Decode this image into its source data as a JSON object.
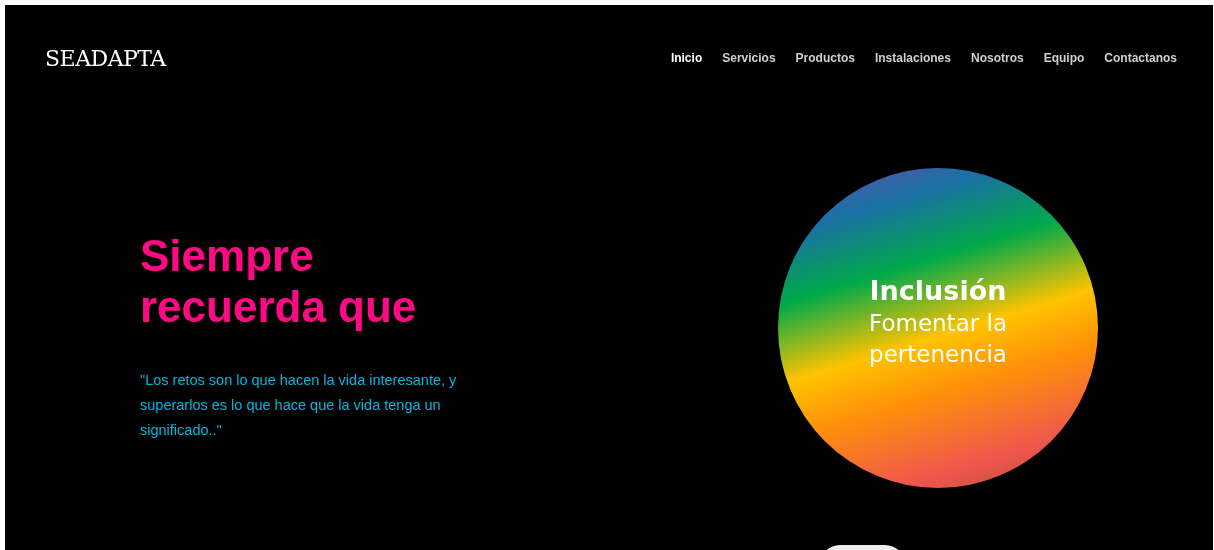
{
  "logo": "SEADAPTA",
  "nav": [
    {
      "label": "Inicio",
      "selected": true
    },
    {
      "label": "Servicios",
      "selected": false
    },
    {
      "label": "Productos",
      "selected": false
    },
    {
      "label": "Instalaciones",
      "selected": false
    },
    {
      "label": "Nosotros",
      "selected": false
    },
    {
      "label": "Equipo",
      "selected": false
    },
    {
      "label": "Contactanos",
      "selected": false
    }
  ],
  "hero": {
    "headline": "Siempre recuerda que",
    "quote": "\"Los retos son lo que hacen la vida interesante, y superarlos es lo que hace que la vida tenga un significado..\""
  },
  "circle": {
    "title": "Inclusión",
    "subtitle": "Fomentar la pertenencia"
  }
}
